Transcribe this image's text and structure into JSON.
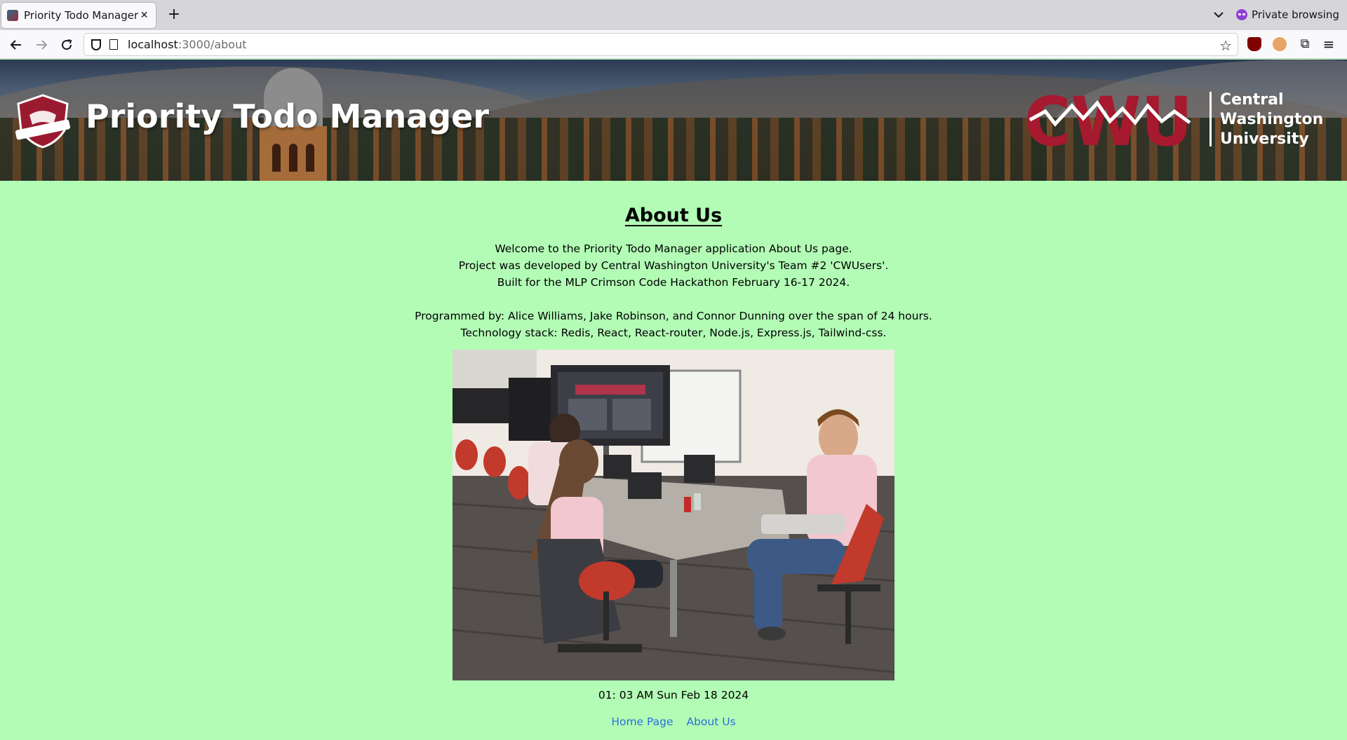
{
  "browser": {
    "tab_title": "Priority Todo Manager",
    "new_tab_glyph": "+",
    "close_glyph": "✕",
    "private_label": "Private browsing",
    "url_host": "localhost",
    "url_path": ":3000/about"
  },
  "banner": {
    "title": "Priority Todo Manager",
    "crest_label": "CrimsonCode",
    "cwu_letters": "CWU",
    "cwu_name_line1": "Central",
    "cwu_name_line2": "Washington",
    "cwu_name_line3": "University"
  },
  "about": {
    "heading": "About Us",
    "intro_line1": "Welcome to the Priority Todo Manager application About Us page.",
    "intro_line2": "Project was developed by Central Washington University's Team #2 'CWUsers'.",
    "intro_line3": "Built for the MLP Crimson Code Hackathon February 16-17 2024.",
    "credits_line1": "Programmed by: Alice Williams, Jake Robinson, and Connor Dunning over the span of 24 hours.",
    "credits_line2": "Technology stack: Redis, React, React-router, Node.js, Express.js, Tailwind-css."
  },
  "footer": {
    "datetime": "01: 03 AM  Sun Feb 18 2024",
    "links": [
      "Home Page",
      "About Us"
    ]
  },
  "colors": {
    "page_bg": "#b3fcb6",
    "link": "#2b6fd6",
    "cwu_red": "#a6192e"
  }
}
